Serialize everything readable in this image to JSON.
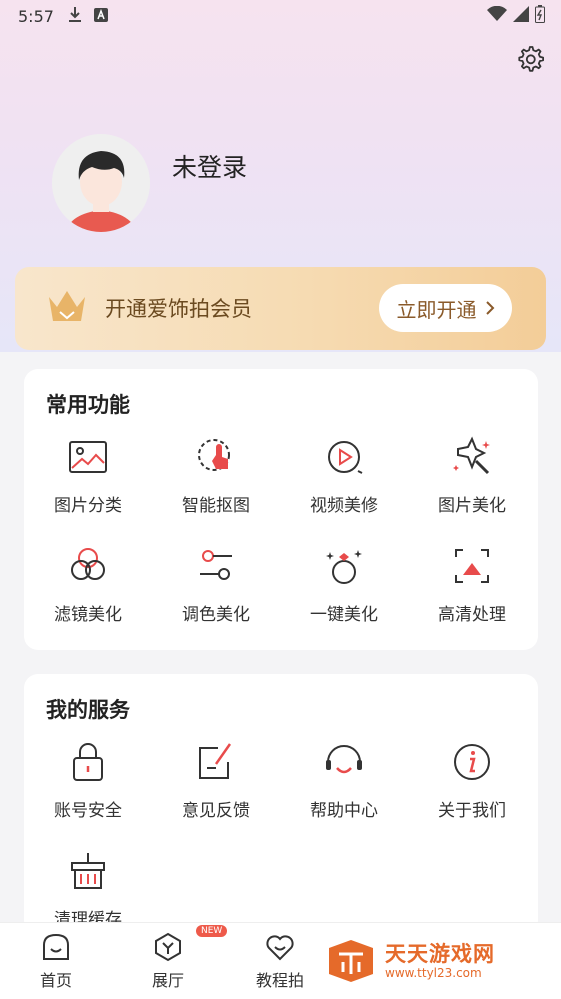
{
  "status_bar": {
    "time": "5:57"
  },
  "profile": {
    "username": "未登录"
  },
  "vip": {
    "text": "开通爱饰拍会员",
    "button": "立即开通"
  },
  "common": {
    "title": "常用功能",
    "items": [
      {
        "label": "图片分类",
        "icon": "image-icon"
      },
      {
        "label": "智能抠图",
        "icon": "cutout-icon"
      },
      {
        "label": "视频美修",
        "icon": "video-icon"
      },
      {
        "label": "图片美化",
        "icon": "sparkle-icon"
      },
      {
        "label": "滤镜美化",
        "icon": "filter-icon"
      },
      {
        "label": "调色美化",
        "icon": "adjust-icon"
      },
      {
        "label": "一键美化",
        "icon": "magic-icon"
      },
      {
        "label": "高清处理",
        "icon": "hd-icon"
      }
    ]
  },
  "services": {
    "title": "我的服务",
    "items": [
      {
        "label": "账号安全",
        "icon": "lock-icon"
      },
      {
        "label": "意见反馈",
        "icon": "feedback-icon"
      },
      {
        "label": "帮助中心",
        "icon": "headset-icon"
      },
      {
        "label": "关于我们",
        "icon": "info-icon"
      },
      {
        "label": "清理缓存",
        "icon": "broom-icon"
      }
    ]
  },
  "tabbar": {
    "items": [
      {
        "label": "首页",
        "icon": "home-icon"
      },
      {
        "label": "展厅",
        "icon": "gallery-icon"
      },
      {
        "label": "教程拍",
        "icon": "heart-icon"
      }
    ],
    "badge": "NEW"
  },
  "watermark": {
    "title": "天天游戏网",
    "url": "www.ttyl23.com"
  },
  "colors": {
    "accent": "#e84b4b",
    "vip_text": "#6b4a20",
    "watermark": "#e56a2a"
  }
}
